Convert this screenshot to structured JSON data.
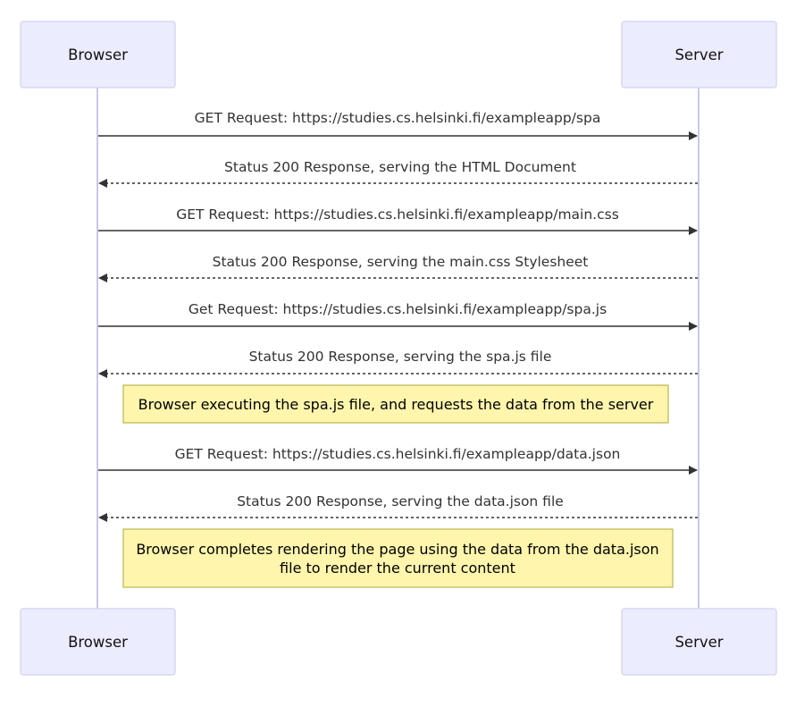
{
  "actors": {
    "left": "Browser",
    "right": "Server"
  },
  "messages": [
    {
      "text": "GET Request: https://studies.cs.helsinki.fi/exampleapp/spa",
      "direction": "to-server",
      "style": "solid"
    },
    {
      "text": "Status 200 Response, serving the HTML Document",
      "direction": "to-browser",
      "style": "dashed"
    },
    {
      "text": "GET Request: https://studies.cs.helsinki.fi/exampleapp/main.css",
      "direction": "to-server",
      "style": "solid"
    },
    {
      "text": "Status 200 Response, serving the main.css Stylesheet",
      "direction": "to-browser",
      "style": "dashed"
    },
    {
      "text": "Get Request: https://studies.cs.helsinki.fi/exampleapp/spa.js",
      "direction": "to-server",
      "style": "solid"
    },
    {
      "text": "Status 200 Response, serving the spa.js file",
      "direction": "to-browser",
      "style": "dashed"
    },
    {
      "text": "GET Request: https://studies.cs.helsinki.fi/exampleapp/data.json",
      "direction": "to-server",
      "style": "solid"
    },
    {
      "text": "Status 200 Response, serving the data.json file",
      "direction": "to-browser",
      "style": "dashed"
    }
  ],
  "notes": [
    {
      "lines": [
        "Browser executing the spa.js file, and requests the data from the server"
      ]
    },
    {
      "lines": [
        "Browser completes rendering the page using the data from the data.json",
        "file to render the current content"
      ]
    }
  ],
  "colors": {
    "actor_fill": "#ECECFF",
    "actor_border": "#D7D7F0",
    "note_fill": "#FFF5AD",
    "note_border": "#AAAA33",
    "arrow": "#333333"
  }
}
